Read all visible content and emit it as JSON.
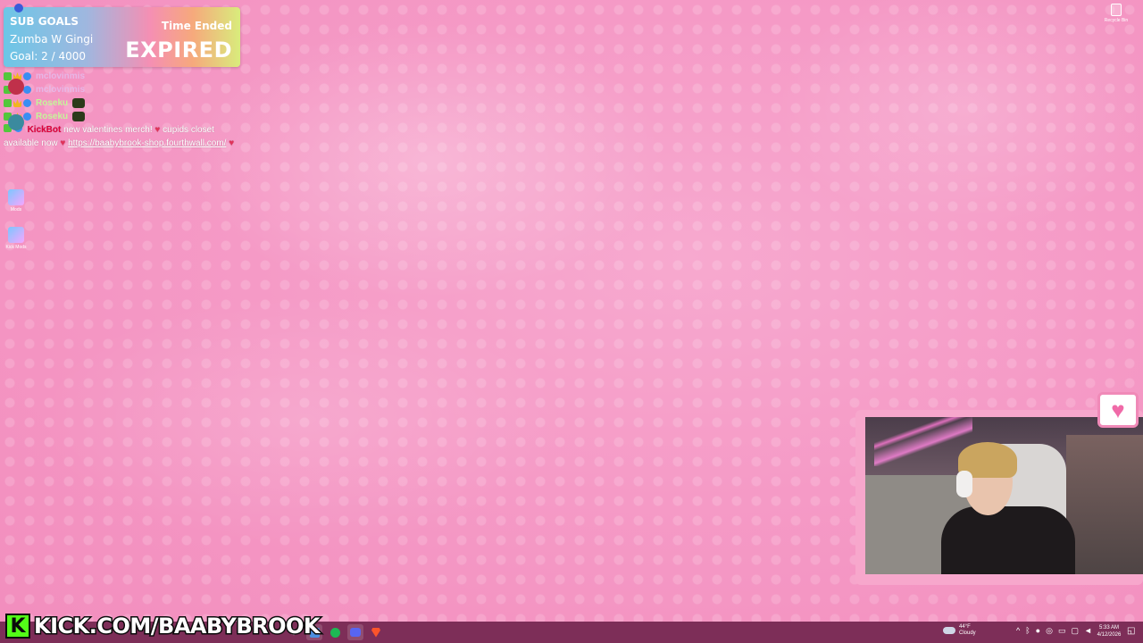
{
  "sub_goals": {
    "title": "SUB GOALS",
    "name": "Zumba W Gingi",
    "goal": "Goal: 2 / 4000",
    "status_label": "Time Ended",
    "status": "EXPIRED"
  },
  "chat": {
    "lines": [
      {
        "user": "mclovinmis",
        "message": ""
      },
      {
        "user": "mclovinmis",
        "message": ""
      },
      {
        "user": "Roseku",
        "message": ""
      },
      {
        "user": "Roseku",
        "message": ""
      },
      {
        "user": "KickBot",
        "message": "new valentines merch!",
        "message2": "cupids closet available now",
        "link": "https://baabybrook-shop.fourthwall.com/"
      }
    ]
  },
  "desktop": {
    "icons": [
      {
        "label": "Start Stream",
        "icon": "app-icon"
      },
      {
        "label": "Spotify",
        "icon": "app-icon"
      },
      {
        "label": "Mods",
        "icon": "folder-icon"
      },
      {
        "label": "Kick Mods",
        "icon": "folder-icon"
      }
    ],
    "recycle_label": "Recycle Bin"
  },
  "overlay": {
    "kick_letter": "K",
    "kick_url": "KICK.COM/BAABYBROOK",
    "heart": "♥"
  },
  "taskbar": {
    "weather_temp": "44°F",
    "weather_desc": "Cloudy",
    "time": "5:33 AM",
    "date": "4/12/2026",
    "tray_chevron": "^"
  },
  "colors": {
    "taskbar": "#7d2e58",
    "kick_green": "#53fc18",
    "wallpaper": "#f59ac6"
  }
}
